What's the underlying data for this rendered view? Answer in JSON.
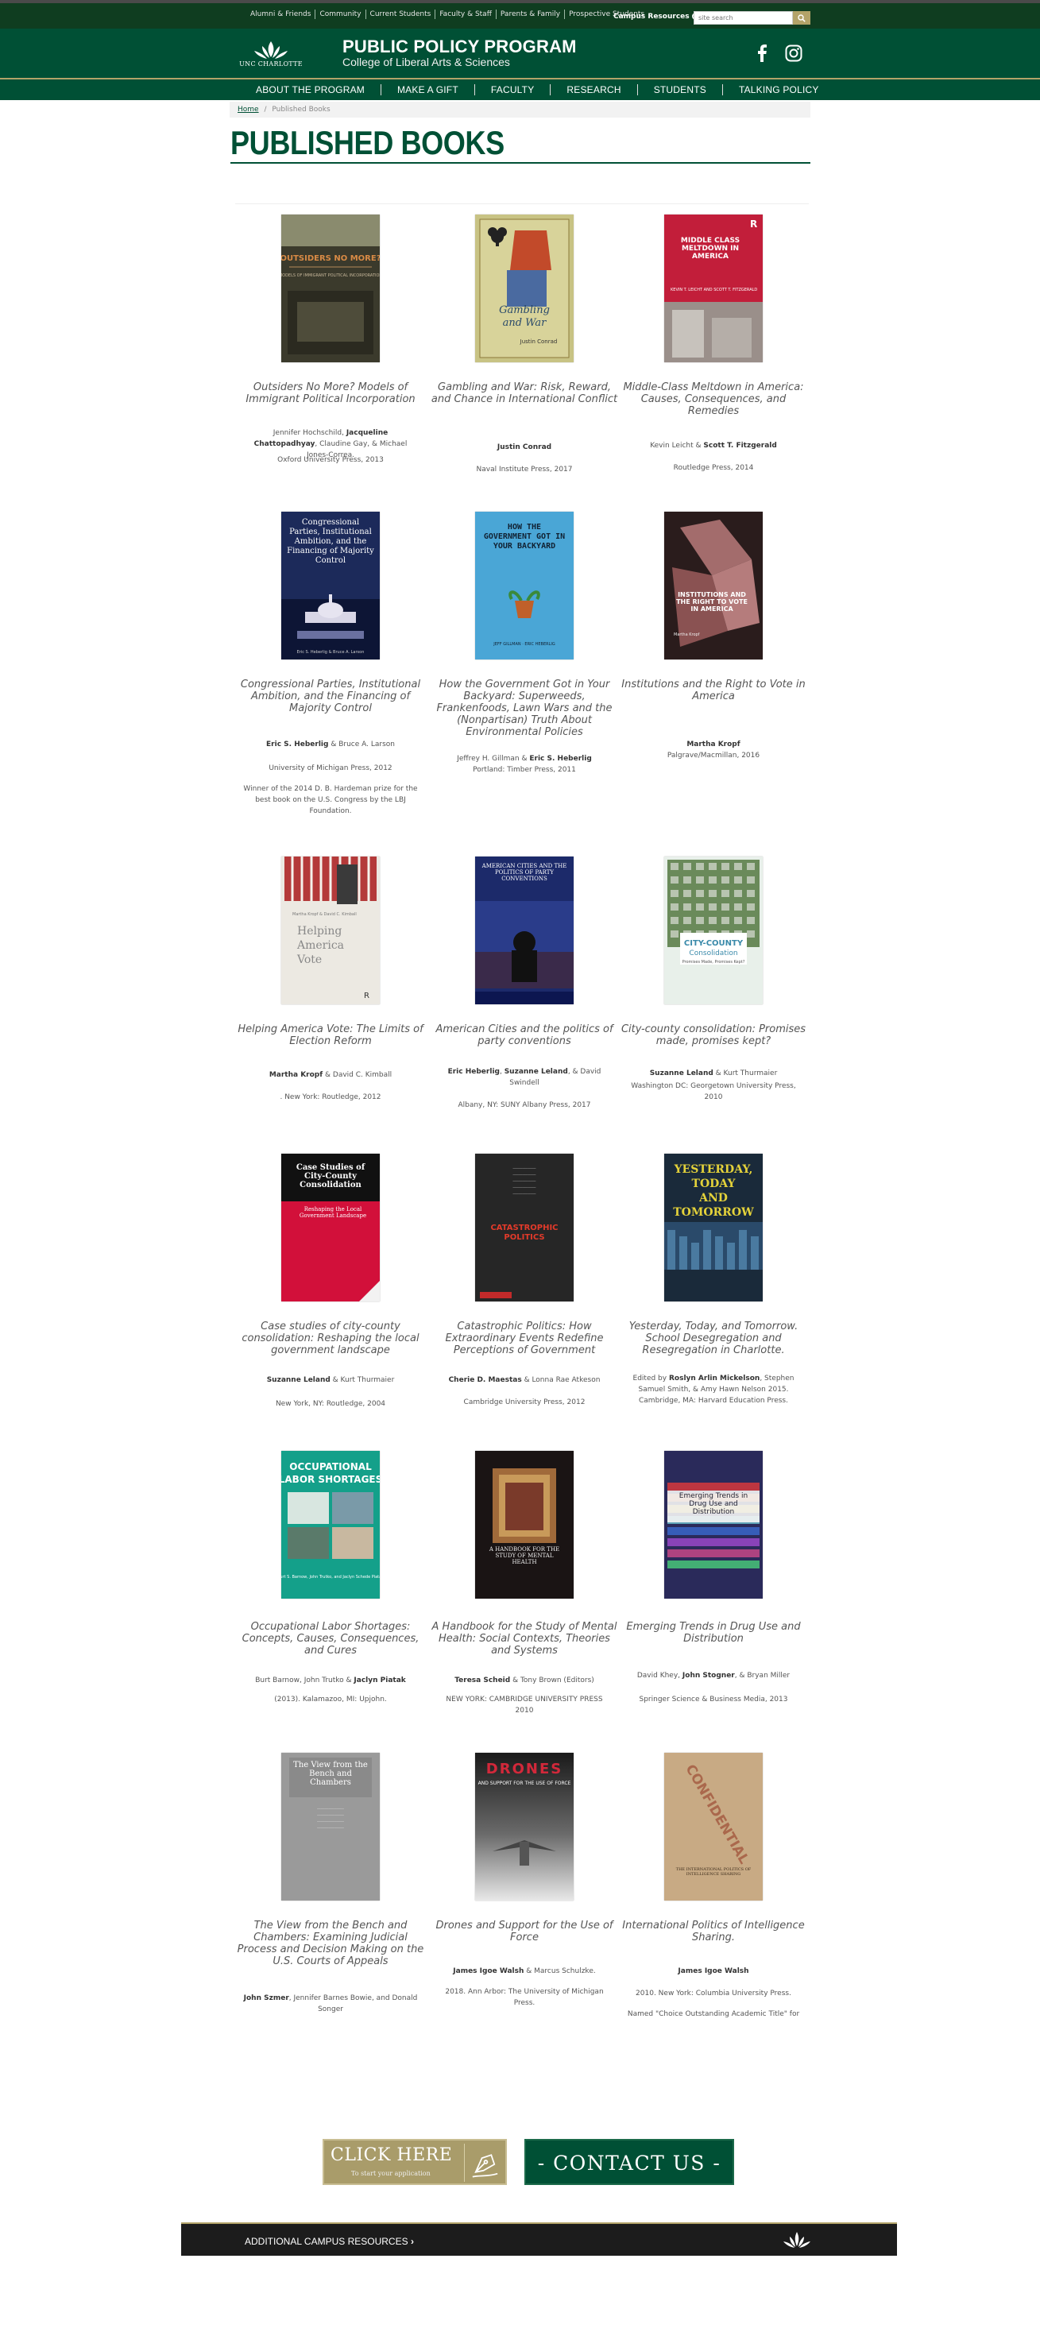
{
  "utility": {
    "links": [
      "Alumni & Friends",
      "Community",
      "Current Students",
      "Faculty & Staff",
      "Parents & Family",
      "Prospective Students"
    ],
    "campus_resources": "Campus Resources",
    "search_placeholder": "site search"
  },
  "header": {
    "logo_text": "UNC CHARLOTTE",
    "title": "PUBLIC POLICY PROGRAM",
    "subtitle": "College of Liberal Arts & Sciences"
  },
  "nav": [
    "ABOUT THE PROGRAM",
    "MAKE A GIFT",
    "FACULTY",
    "RESEARCH",
    "STUDENTS",
    "TALKING POLICY"
  ],
  "breadcrumb": {
    "home": "Home",
    "sep": "/",
    "current": "Published Books"
  },
  "page_title": "PUBLISHED BOOKS",
  "books": [
    {
      "title": "Outsiders No More? Models of Immigrant Political Incorporation",
      "authors": [
        {
          "t": "Jennifer Hochschild, "
        },
        {
          "t": "Jacqueline Chattopadhyay",
          "b": true
        },
        {
          "t": ", Claudine Gay, & Michael Jones-Correa."
        }
      ],
      "publisher": "Oxford University Press, 2013",
      "note": "",
      "cover_text": [
        "OUTSIDERS NO MORE?"
      ]
    },
    {
      "title": "Gambling and War: Risk, Reward, and Chance in International Conflict",
      "authors": [
        {
          "t": "Justin Conrad",
          "b": true
        }
      ],
      "publisher": "Naval Institute Press, 2017",
      "note": "",
      "cover_text": [
        "Gambling",
        "and War",
        "Justin Conrad"
      ]
    },
    {
      "title": "Middle-Class Meltdown in America: Causes, Consequences, and Remedies",
      "authors": [
        {
          "t": "Kevin Leicht & "
        },
        {
          "t": "Scott T. Fitzgerald",
          "b": true
        }
      ],
      "publisher": "Routledge Press, 2014",
      "note": "",
      "cover_text": [
        "MIDDLE CLASS MELTDOWN IN AMERICA",
        "KEVIN T. LEICHT AND SCOTT T. FITZGERALD"
      ]
    },
    {
      "title": "Congressional Parties, Institutional Ambition, and the Financing of Majority Control",
      "authors": [
        {
          "t": "Eric S. Heberlig",
          "b": true
        },
        {
          "t": " & Bruce A. Larson"
        }
      ],
      "publisher": "University of Michigan Press, 2012",
      "note": "Winner of the 2014 D. B. Hardeman prize for the best book on the U.S. Congress by the LBJ Foundation.",
      "cover_text": [
        "Congressional Parties, Institutional Ambition, and the Financing of Majority Control",
        "Eric S. Heberlig & Bruce A. Larson"
      ]
    },
    {
      "title": "How the Government Got in Your Backyard: Superweeds, Frankenfoods, Lawn Wars and the (Nonpartisan) Truth About Environmental Policies",
      "authors": [
        {
          "t": "Jeffrey H. Gillman & "
        },
        {
          "t": "Eric S. Heberlig",
          "b": true
        }
      ],
      "publisher": "Portland: Timber Press, 2011",
      "note": "",
      "cover_text": [
        "HOW THE GOVERNMENT GOT IN YOUR BACKYARD",
        "JEFF GILLMAN · ERIC HEBERLIG"
      ]
    },
    {
      "title": "Institutions and the Right to Vote in America",
      "authors": [
        {
          "t": "Martha Kropf",
          "b": true
        }
      ],
      "publisher": "Palgrave/Macmillan, 2016",
      "note": "",
      "cover_text": [
        "INSTITUTIONS AND THE RIGHT TO VOTE IN AMERICA",
        "Martha Kropf"
      ]
    },
    {
      "title": "Helping America Vote: The Limits of Election Reform",
      "authors": [
        {
          "t": "Martha Kropf",
          "b": true
        },
        {
          "t": " & David C. Kimball"
        }
      ],
      "publisher": ". New York: Routledge, 2012",
      "note": "",
      "cover_text": [
        "Helping",
        "America",
        "Vote"
      ]
    },
    {
      "title": "American Cities and the politics of party conventions",
      "authors": [
        {
          "t": "Eric Heberlig",
          "b": true
        },
        {
          "t": ", "
        },
        {
          "t": "Suzanne Leland",
          "b": true
        },
        {
          "t": ", & David Swindell"
        }
      ],
      "publisher": "Albany, NY: SUNY Albany Press, 2017",
      "note": "",
      "cover_text": [
        "AMERICAN CITIES AND THE POLITICS OF PARTY CONVENTIONS"
      ]
    },
    {
      "title": "City-county consolidation: Promises made, promises kept?",
      "authors": [
        {
          "t": "Suzanne Leland",
          "b": true
        },
        {
          "t": " & Kurt Thurmaier"
        }
      ],
      "publisher": "Washington DC: Georgetown University Press, 2010",
      "note": "",
      "cover_text": [
        "CITY-COUNTY",
        "Consolidation",
        "Promises Made, Promises Kept?"
      ]
    },
    {
      "title": "Case studies of city-county consolidation: Reshaping the local government landscape",
      "authors": [
        {
          "t": "Suzanne Leland",
          "b": true
        },
        {
          "t": " & Kurt Thurmaier"
        }
      ],
      "publisher": "New York, NY: Routledge, 2004",
      "note": "",
      "cover_text": [
        "Case Studies of City-County Consolidation",
        "Reshaping the Local Government Landscape"
      ]
    },
    {
      "title": "Catastrophic Politics: How Extraordinary Events Redefine Perceptions of Government",
      "authors": [
        {
          "t": "Cherie D. Maestas",
          "b": true
        },
        {
          "t": " & Lonna Rae Atkeson"
        }
      ],
      "publisher": "Cambridge University Press, 2012",
      "note": "",
      "cover_text": [
        "CATASTROPHIC",
        "POLITICS"
      ]
    },
    {
      "title": "Yesterday, Today, and Tomorrow. School Desegregation and Resegregation in Charlotte.",
      "authors": [
        {
          "t": "Edited by "
        },
        {
          "t": "Roslyn Arlin Mickelson",
          "b": true
        },
        {
          "t": ", Stephen Samuel Smith, & Amy Hawn Nelson 2015. Cambridge, MA: Harvard Education Press."
        }
      ],
      "publisher": "",
      "note": "",
      "cover_text": [
        "YESTERDAY,",
        "TODAY",
        "AND",
        "TOMORROW"
      ]
    },
    {
      "title": "Occupational Labor Shortages: Concepts, Causes, Consequences, and Cures",
      "authors": [
        {
          "t": "Burt Barnow, John Trutko & "
        },
        {
          "t": "Jaclyn Piatak",
          "b": true
        }
      ],
      "publisher": "(2013). Kalamazoo, MI: Upjohn.",
      "note": "",
      "cover_text": [
        "OCCUPATIONAL",
        "LABOR SHORTAGES"
      ]
    },
    {
      "title": "A Handbook for the Study of Mental Health: Social Contexts, Theories and Systems",
      "authors": [
        {
          "t": "Teresa Scheid",
          "b": true
        },
        {
          "t": " & Tony Brown (Editors)"
        }
      ],
      "publisher": "NEW YORK: CAMBRIDGE UNIVERSITY PRESS 2010",
      "note": "",
      "cover_text": [
        "A HANDBOOK FOR THE STUDY OF MENTAL HEALTH"
      ]
    },
    {
      "title": "Emerging Trends in Drug Use and Distribution",
      "authors": [
        {
          "t": "David Khey, "
        },
        {
          "t": "John Stogner",
          "b": true
        },
        {
          "t": ", & Bryan Miller"
        }
      ],
      "publisher": "Springer Science & Business Media, 2013",
      "note": "",
      "cover_text": [
        "Emerging Trends in Drug Use and Distribution"
      ]
    },
    {
      "title": "The View from the Bench and Chambers: Examining Judicial Process and Decision Making on the U.S. Courts of Appeals",
      "authors": [
        {
          "t": "John Szmer",
          "b": true
        },
        {
          "t": ", Jennifer Barnes Bowie, and Donald Songer"
        }
      ],
      "publisher": "",
      "note": "",
      "cover_text": [
        "The View from the Bench and Chambers"
      ]
    },
    {
      "title": "Drones and Support for the Use of Force",
      "authors": [
        {
          "t": "James Igoe Walsh",
          "b": true
        },
        {
          "t": " & Marcus Schulzke."
        }
      ],
      "publisher": "2018. Ann Arbor: The University of Michigan Press.",
      "note": "",
      "cover_text": [
        "DRONES",
        "AND SUPPORT FOR THE USE OF FORCE"
      ]
    },
    {
      "title": "International Politics of Intelligence Sharing.",
      "authors": [
        {
          "t": "James Igoe Walsh",
          "b": true
        }
      ],
      "publisher": "2010. New York: Columbia University Press.",
      "note": "Named \"Choice Outstanding Academic Title\" for",
      "cover_text": [
        "CONFIDENTIAL",
        "THE INTERNATIONAL POLITICS OF INTELLIGENCE SHARING"
      ]
    }
  ],
  "cta": {
    "click_here": "CLICK HERE",
    "click_sub": "To start your application",
    "contact": "- CONTACT US -"
  },
  "footer": {
    "label": "ADDITIONAL CAMPUS RESOURCES"
  },
  "colors": {
    "brand_green": "#005035",
    "gold": "#b3a369",
    "dark_green": "#0f3d20"
  },
  "icons": {
    "facebook": "facebook-icon",
    "instagram": "instagram-icon",
    "search": "search-icon",
    "pen": "pen-nib-icon"
  }
}
